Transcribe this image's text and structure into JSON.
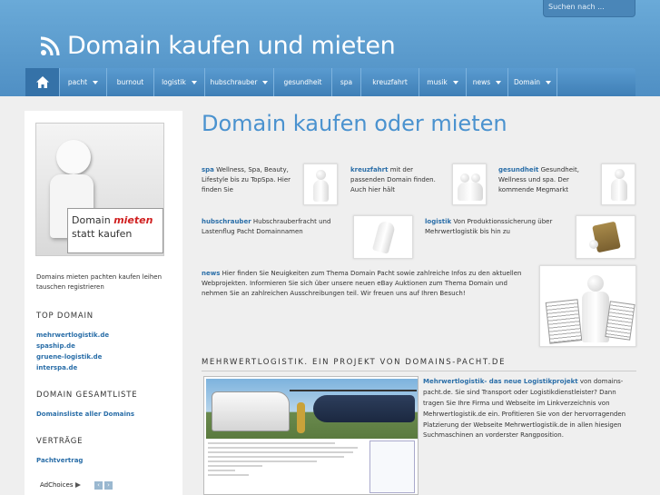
{
  "header": {
    "site_title": "Domain kaufen und mieten",
    "search_placeholder": "Suchen nach ..."
  },
  "nav": {
    "items": [
      {
        "label": "pacht",
        "dropdown": true
      },
      {
        "label": "burnout",
        "dropdown": false
      },
      {
        "label": "logistik",
        "dropdown": true
      },
      {
        "label": "hubschrauber",
        "dropdown": true
      },
      {
        "label": "gesundheit",
        "dropdown": false
      },
      {
        "label": "spa",
        "dropdown": false
      },
      {
        "label": "kreuzfahrt",
        "dropdown": false
      },
      {
        "label": "musik",
        "dropdown": true
      },
      {
        "label": "news",
        "dropdown": true
      },
      {
        "label": "Domain",
        "dropdown": true
      }
    ]
  },
  "sidebar": {
    "promo_line1": "Domain",
    "promo_line1_red": "mieten",
    "promo_line2": "statt kaufen",
    "intro": "Domains mieten pachten kaufen leihen tauschen registrieren",
    "top_domain_heading": "TOP DOMAIN",
    "top_domains": [
      "mehrwertlogistik.de",
      "spaship.de",
      "gruene-logistik.de",
      "interspa.de"
    ],
    "gesamtliste_heading": "DOMAIN GESAMTLISTE",
    "gesamtliste_link": "Domainsliste aller Domains",
    "vertraege_heading": "VERTRÄGE",
    "vertraege_link": "Pachtvertrag",
    "adchoices": "AdChoices"
  },
  "main": {
    "title": "Domain kaufen oder mieten",
    "blurbs": {
      "spa": {
        "kw": "spa",
        "text": " Wellness, Spa, Beauty, Lifestyle bis zu TopSpa. Hier finden Sie"
      },
      "kreuzfahrt": {
        "kw": "kreuzfahrt",
        "text": " mit der passenden Domain finden. Auch hier hält"
      },
      "gesundheit": {
        "kw": "gesundheit",
        "text": " Gesundheit, Wellness und spa. Der kommende Megmarkt"
      },
      "hubschrauber": {
        "kw": "hubschrauber",
        "text": " Hubschrauberfracht und Lastenflug Pacht Domainnamen"
      },
      "logistik": {
        "kw": "logistik",
        "text": " Von Produktionssicherung über Mehrwertlogistik bis hin zu"
      },
      "news": {
        "kw": "news",
        "text": " Hier finden Sie Neuigkeiten zum Thema Domain Pacht sowie zahlreiche Infos zu den aktuellen Webprojekten. Informieren Sie sich über unsere neuen eBay Auktionen zum Thema Domain und nehmen Sie an zahlreichen Ausschreibungen teil. Wir freuen uns auf Ihren Besuch!"
      }
    },
    "section_title": "MEHRWERTLOGISTIK. EIN PROJEKT VON DOMAINS-PACHT.DE",
    "project_kw": "Mehrwertlogistik- das neue Logistikprojekt",
    "project_text": " von domains-pacht.de. Sie sind Transport oder Logistikdienstleister? Dann tragen Sie Ihre Firma und Webseite im Linkverzeichnis von Mehrwertlogistik.de ein. Profitieren Sie von der hervorragenden Platzierung der Webseite Mehrwertlogistik.de in allen hiesigen Suchmaschinen an vorderster Rangposition."
  }
}
